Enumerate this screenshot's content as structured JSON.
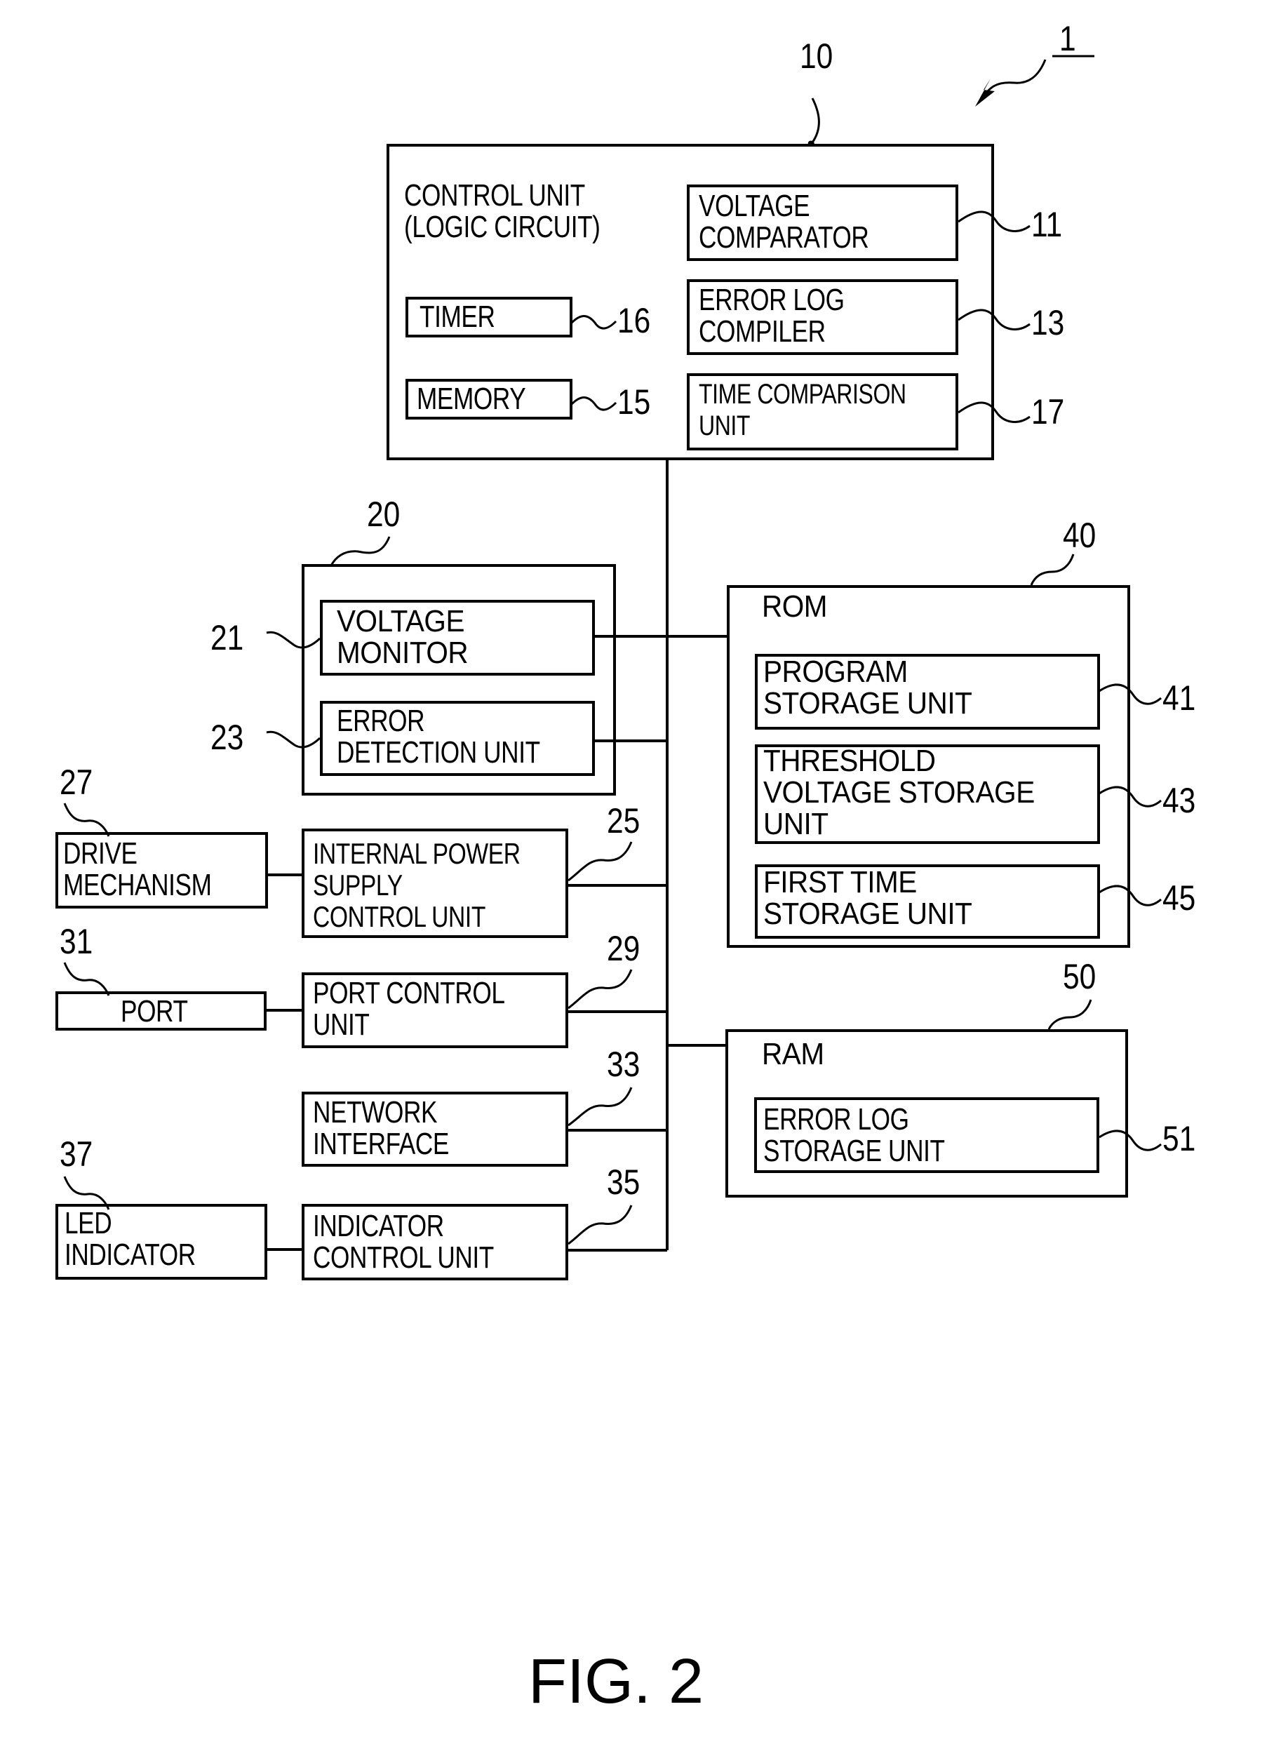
{
  "figure": {
    "caption": "FIG. 2",
    "device_ref": "1"
  },
  "blocks": {
    "control_unit": {
      "ref": "10",
      "label": "CONTROL UNIT\n(LOGIC CIRCUIT)"
    },
    "voltage_comparator": {
      "ref": "11",
      "label": "VOLTAGE\nCOMPARATOR"
    },
    "error_log_compiler": {
      "ref": "13",
      "label": "ERROR LOG\nCOMPILER"
    },
    "time_comparison_unit": {
      "ref": "17",
      "label": "TIME COMPARISON\nUNIT"
    },
    "timer": {
      "ref": "16",
      "label": "TIMER"
    },
    "memory": {
      "ref": "15",
      "label": "MEMORY"
    },
    "monitor_block": {
      "ref": "20"
    },
    "voltage_monitor": {
      "ref": "21",
      "label": "VOLTAGE\nMONITOR"
    },
    "error_detection_unit": {
      "ref": "23",
      "label": "ERROR\nDETECTION UNIT"
    },
    "internal_power_supply_control_unit": {
      "ref": "25",
      "label": "INTERNAL POWER\nSUPPLY\nCONTROL UNIT"
    },
    "drive_mechanism": {
      "ref": "27",
      "label": "DRIVE\nMECHANISM"
    },
    "port_control_unit": {
      "ref": "29",
      "label": "PORT CONTROL\nUNIT"
    },
    "port": {
      "ref": "31",
      "label": "PORT"
    },
    "network_interface": {
      "ref": "33",
      "label": "NETWORK\nINTERFACE"
    },
    "indicator_control_unit": {
      "ref": "35",
      "label": "INDICATOR\nCONTROL UNIT"
    },
    "led_indicator": {
      "ref": "37",
      "label": "LED\nINDICATOR"
    },
    "rom": {
      "ref": "40",
      "label": "ROM"
    },
    "program_storage_unit": {
      "ref": "41",
      "label": "PROGRAM\nSTORAGE UNIT"
    },
    "threshold_voltage_storage_unit": {
      "ref": "43",
      "label": "THRESHOLD\nVOLTAGE STORAGE\nUNIT"
    },
    "first_time_storage_unit": {
      "ref": "45",
      "label": "FIRST TIME\nSTORAGE UNIT"
    },
    "ram": {
      "ref": "50",
      "label": "RAM"
    },
    "error_log_storage_unit": {
      "ref": "51",
      "label": "ERROR LOG\nSTORAGE UNIT"
    }
  },
  "connections": [
    [
      "control_unit",
      "bus"
    ],
    [
      "voltage_monitor",
      "bus"
    ],
    [
      "error_detection_unit",
      "bus"
    ],
    [
      "internal_power_supply_control_unit",
      "bus"
    ],
    [
      "drive_mechanism",
      "internal_power_supply_control_unit"
    ],
    [
      "port_control_unit",
      "bus"
    ],
    [
      "port",
      "port_control_unit"
    ],
    [
      "network_interface",
      "bus"
    ],
    [
      "indicator_control_unit",
      "bus"
    ],
    [
      "led_indicator",
      "indicator_control_unit"
    ],
    [
      "rom",
      "bus"
    ],
    [
      "ram",
      "bus"
    ]
  ]
}
